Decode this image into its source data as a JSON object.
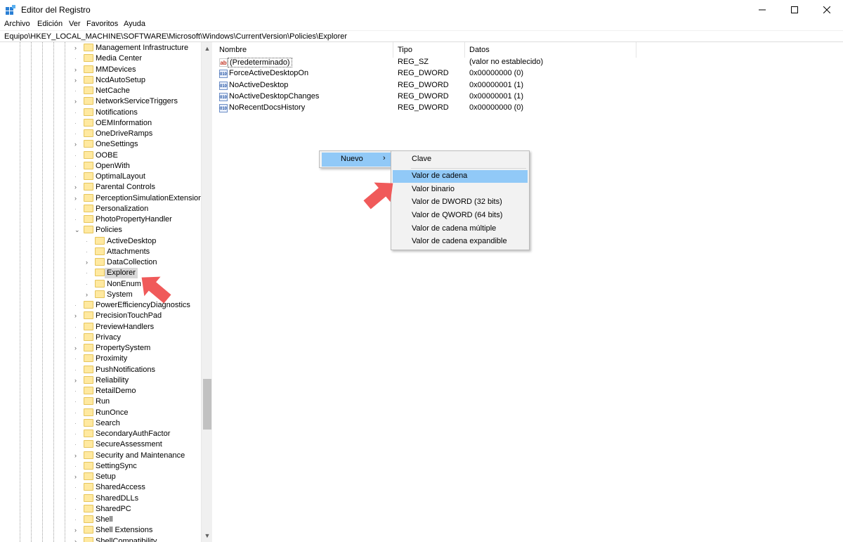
{
  "window": {
    "title": "Editor del Registro",
    "colors": {
      "accent": "#0078d7",
      "selection": "#91c9f7",
      "folder": "#ffe9a0",
      "arrow": "#f05a5a"
    }
  },
  "menu": [
    "Archivo",
    "Edición",
    "Ver",
    "Favoritos",
    "Ayuda"
  ],
  "address": "Equipo\\HKEY_LOCAL_MACHINE\\SOFTWARE\\Microsoft\\Windows\\CurrentVersion\\Policies\\Explorer",
  "tree": {
    "items": [
      "Management Infrastructure",
      "Media Center",
      "MMDevices",
      "NcdAutoSetup",
      "NetCache",
      "NetworkServiceTriggers",
      "Notifications",
      "OEMInformation",
      "OneDriveRamps",
      "OneSettings",
      "OOBE",
      "OpenWith",
      "OptimalLayout",
      "Parental Controls",
      "PerceptionSimulationExtensions",
      "Personalization",
      "PhotoPropertyHandler",
      "Policies",
      "ActiveDesktop",
      "Attachments",
      "DataCollection",
      "Explorer",
      "NonEnum",
      "System",
      "PowerEfficiencyDiagnostics",
      "PrecisionTouchPad",
      "PreviewHandlers",
      "Privacy",
      "PropertySystem",
      "Proximity",
      "PushNotifications",
      "Reliability",
      "RetailDemo",
      "Run",
      "RunOnce",
      "Search",
      "SecondaryAuthFactor",
      "SecureAssessment",
      "Security and Maintenance",
      "SettingSync",
      "Setup",
      "SharedAccess",
      "SharedDLLs",
      "SharedPC",
      "Shell",
      "Shell Extensions",
      "ShellCompatibility"
    ],
    "selected": "Explorer"
  },
  "list": {
    "columns": [
      "Nombre",
      "Tipo",
      "Datos"
    ],
    "rows": [
      {
        "name": "(Predeterminado)",
        "type": "REG_SZ",
        "data": "(valor no establecido)",
        "icon": "string-value-icon"
      },
      {
        "name": "ForceActiveDesktopOn",
        "type": "REG_DWORD",
        "data": "0x00000000 (0)",
        "icon": "dword-value-icon"
      },
      {
        "name": "NoActiveDesktop",
        "type": "REG_DWORD",
        "data": "0x00000001 (1)",
        "icon": "dword-value-icon"
      },
      {
        "name": "NoActiveDesktopChanges",
        "type": "REG_DWORD",
        "data": "0x00000001 (1)",
        "icon": "dword-value-icon"
      },
      {
        "name": "NoRecentDocsHistory",
        "type": "REG_DWORD",
        "data": "0x00000000 (0)",
        "icon": "dword-value-icon"
      }
    ]
  },
  "context_menu": {
    "item": "Nuevo",
    "submenu": [
      "Clave",
      "Valor de cadena",
      "Valor binario",
      "Valor de DWORD (32 bits)",
      "Valor de QWORD (64 bits)",
      "Valor de cadena múltiple",
      "Valor de cadena expandible"
    ],
    "highlighted": "Valor de cadena"
  }
}
